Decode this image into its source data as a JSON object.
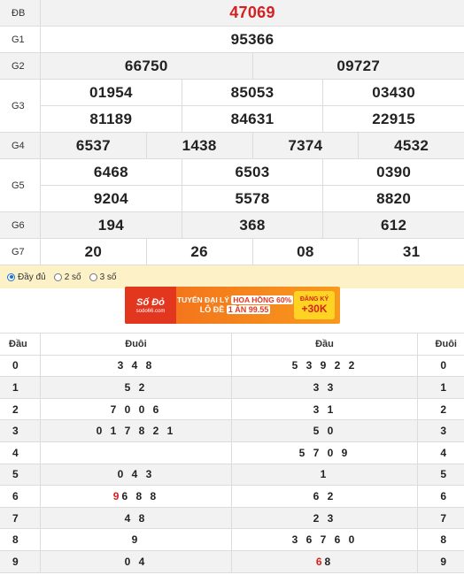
{
  "results": [
    {
      "label": "ĐB",
      "lines": [
        [
          "47069"
        ]
      ],
      "special": true
    },
    {
      "label": "G1",
      "lines": [
        [
          "95366"
        ]
      ]
    },
    {
      "label": "G2",
      "lines": [
        [
          "66750",
          "09727"
        ]
      ]
    },
    {
      "label": "G3",
      "lines": [
        [
          "01954",
          "85053",
          "03430"
        ],
        [
          "81189",
          "84631",
          "22915"
        ]
      ]
    },
    {
      "label": "G4",
      "lines": [
        [
          "6537",
          "1438",
          "7374",
          "4532"
        ]
      ]
    },
    {
      "label": "G5",
      "lines": [
        [
          "6468",
          "6503",
          "0390"
        ],
        [
          "9204",
          "5578",
          "8820"
        ]
      ]
    },
    {
      "label": "G6",
      "lines": [
        [
          "194",
          "368",
          "612"
        ]
      ]
    },
    {
      "label": "G7",
      "lines": [
        [
          "20",
          "26",
          "08",
          "31"
        ]
      ]
    }
  ],
  "options": [
    {
      "label": "Đầy đủ",
      "selected": true
    },
    {
      "label": "2 số",
      "selected": false
    },
    {
      "label": "3 số",
      "selected": false
    }
  ],
  "banner": {
    "logo_text": "Số Đỏ",
    "logo_sub": "sodo66.com",
    "line1_a": "TUYỂN ĐẠI LÝ",
    "line1_b": "HOA HỒNG 60%",
    "line2_a": "LÔ ĐỀ",
    "line2_b": "1 ĂN 99.55",
    "cta_top": "ĐĂNG KÝ",
    "cta_bottom": "+30K"
  },
  "headtail": {
    "headers": [
      "Đầu",
      "Đuôi",
      "Đầu",
      "Đuôi"
    ],
    "rows": [
      {
        "head": "0",
        "tails": "3 4 8",
        "tails_red": "",
        "heads": "5 3 9 2 2",
        "heads_red": "",
        "tail": "0"
      },
      {
        "head": "1",
        "tails": "5 2",
        "tails_red": "",
        "heads": "3 3",
        "heads_red": "",
        "tail": "1"
      },
      {
        "head": "2",
        "tails": "7 0 0 6",
        "tails_red": "",
        "heads": "3 1",
        "heads_red": "",
        "tail": "2"
      },
      {
        "head": "3",
        "tails": "0 1 7 8 2 1",
        "tails_red": "",
        "heads": "5 0",
        "heads_red": "",
        "tail": "3"
      },
      {
        "head": "4",
        "tails": "",
        "tails_red": "",
        "heads": "5 7 0 9",
        "heads_red": "",
        "tail": "4"
      },
      {
        "head": "5",
        "tails": "0 4 3",
        "tails_red": "",
        "heads": "1",
        "heads_red": "",
        "tail": "5"
      },
      {
        "head": "6",
        "tails": " 6 8 8",
        "tails_red": "9",
        "heads": "6 2",
        "heads_red": "",
        "tail": "6"
      },
      {
        "head": "7",
        "tails": "4 8",
        "tails_red": "",
        "heads": "2 3",
        "heads_red": "",
        "tail": "7"
      },
      {
        "head": "8",
        "tails": "9",
        "tails_red": "",
        "heads": "3 6 7 6 0",
        "heads_red": "",
        "tail": "8"
      },
      {
        "head": "9",
        "tails": "0 4",
        "tails_red": "",
        "heads": " 8",
        "heads_red": "6",
        "tail": "9"
      }
    ]
  }
}
